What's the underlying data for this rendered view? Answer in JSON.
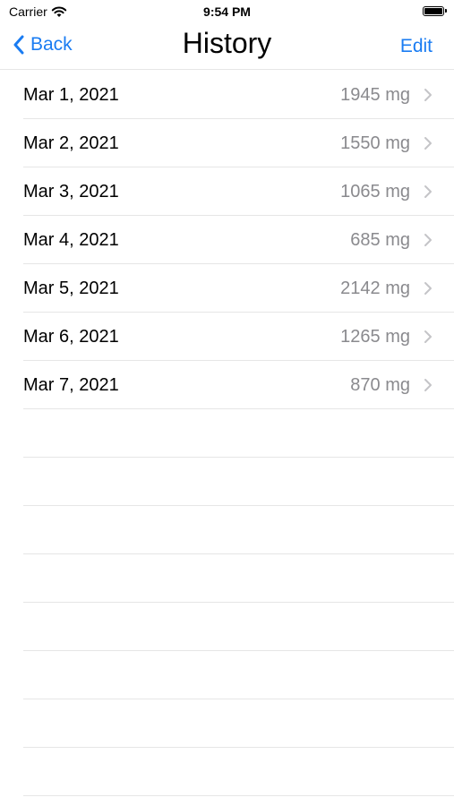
{
  "status_bar": {
    "carrier": "Carrier",
    "time": "9:54 PM"
  },
  "nav": {
    "back_label": "Back",
    "title": "History",
    "edit_label": "Edit"
  },
  "entries": [
    {
      "date": "Mar 1, 2021",
      "value": "1945 mg"
    },
    {
      "date": "Mar 2, 2021",
      "value": "1550 mg"
    },
    {
      "date": "Mar 3, 2021",
      "value": "1065 mg"
    },
    {
      "date": "Mar 4, 2021",
      "value": "685 mg"
    },
    {
      "date": "Mar 5, 2021",
      "value": "2142 mg"
    },
    {
      "date": "Mar 6, 2021",
      "value": "1265 mg"
    },
    {
      "date": "Mar 7, 2021",
      "value": "870 mg"
    }
  ],
  "colors": {
    "accent": "#1a7cf2",
    "secondary_text": "#8a8a8e",
    "separator": "#e6e6e6"
  }
}
